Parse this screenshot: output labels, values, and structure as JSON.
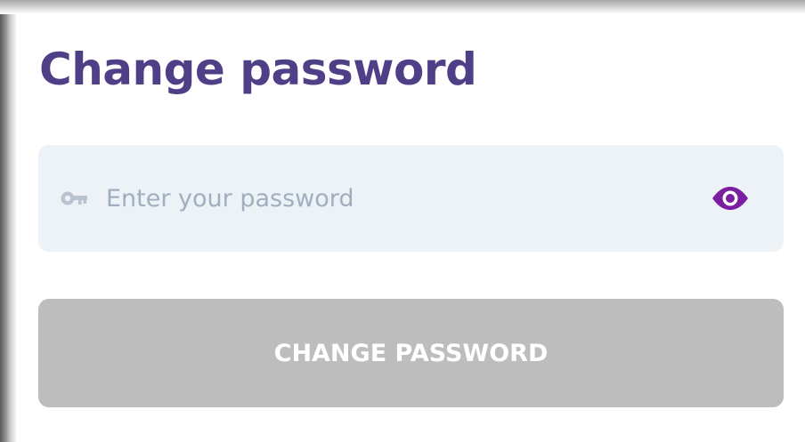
{
  "form": {
    "title": "Change password",
    "password_field": {
      "placeholder": "Enter your password",
      "value": "",
      "leading_icon": "key-icon",
      "trailing_icon": "eye-icon"
    },
    "submit_button": {
      "label": "CHANGE PASSWORD",
      "disabled": true
    }
  },
  "colors": {
    "title": "#4f3f86",
    "field_background": "#edf2f7",
    "placeholder": "#a0aec0",
    "eye_icon": "#7b1fa2",
    "button_disabled": "#bdbdbd",
    "button_text": "#ffffff"
  }
}
